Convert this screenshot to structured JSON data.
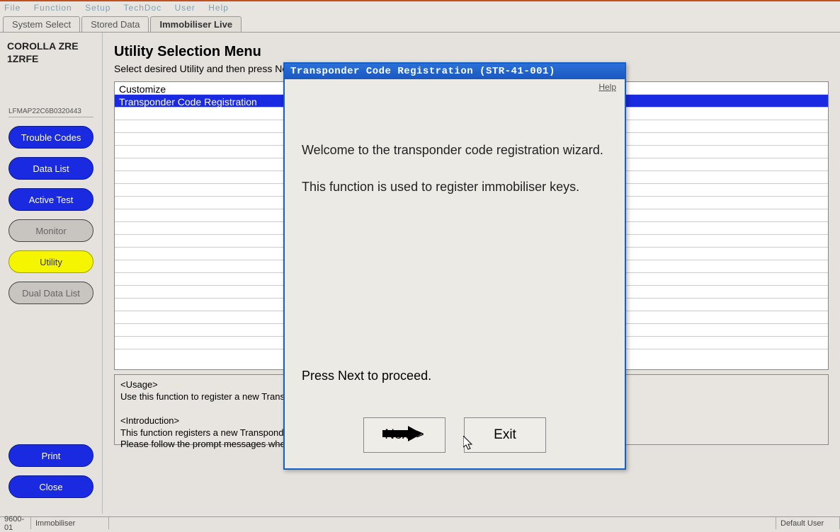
{
  "menubar": [
    "File",
    "Function",
    "Setup",
    "TechDoc",
    "User",
    "Help"
  ],
  "tabs": {
    "system_select": "System Select",
    "stored_data": "Stored Data",
    "immobiliser_live": "Immobiliser Live"
  },
  "sidebar": {
    "vehicle": "COROLLA ZRE 1ZRFE",
    "vin": "LFMAP22C6B0320443",
    "buttons": {
      "trouble_codes": "Trouble Codes",
      "data_list": "Data List",
      "active_test": "Active Test",
      "monitor": "Monitor",
      "utility": "Utility",
      "dual_data_list": "Dual Data List",
      "print": "Print",
      "close": "Close"
    }
  },
  "content": {
    "title": "Utility Selection Menu",
    "subtitle": "Select desired Utility and then press Next",
    "list": [
      "Customize",
      "Transponder Code Registration"
    ],
    "info_usage": "<Usage>",
    "info_usage_text": "Use this function to register a new Transp",
    "info_intro": "<Introduction>",
    "info_intro_text1": "This function registers a new Transponde",
    "info_intro_text2": "Please follow the prompt messages whe"
  },
  "dialog": {
    "title": "Transponder Code Registration (STR-41-001)",
    "help": "Help",
    "welcome": "Welcome to the transponder code registration wizard.",
    "desc": "This function is used to register immobiliser keys.",
    "proceed": "Press Next to proceed.",
    "next": "Next >",
    "exit": "Exit"
  },
  "status": {
    "code": "9600-01",
    "module": "Immobiliser",
    "user": "Default User"
  }
}
